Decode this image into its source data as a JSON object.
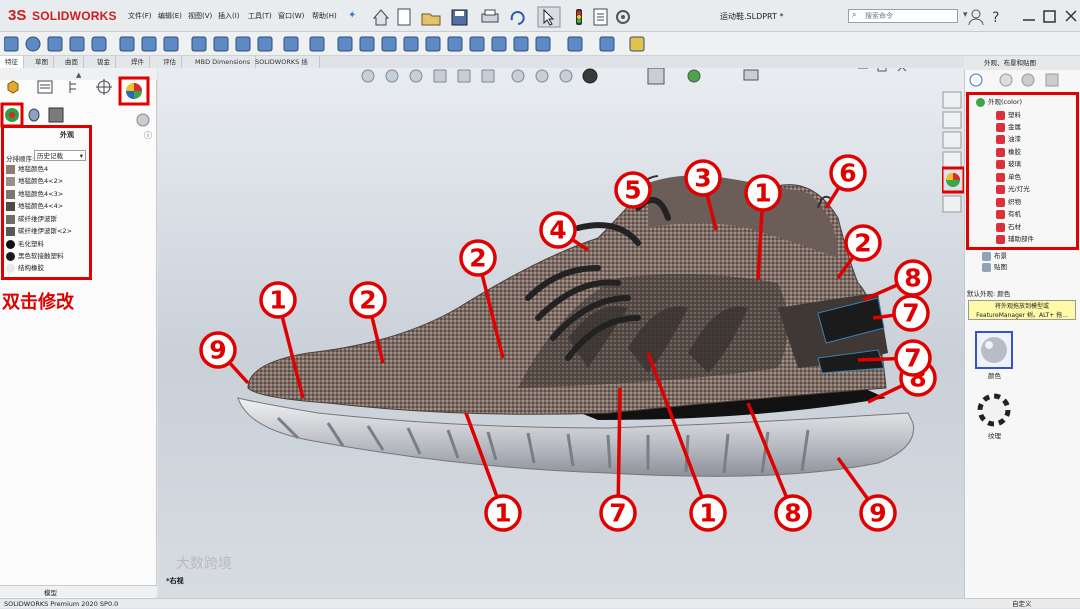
{
  "app": {
    "brand_prefix": "3S",
    "brand_name": "SOLIDWORKS",
    "menus": [
      "文件(F)",
      "编辑(E)",
      "视图(V)",
      "插入(I)",
      "工具(T)",
      "窗口(W)",
      "帮助(H)"
    ],
    "document_title": "运动鞋.SLDPRT *",
    "search_placeholder": "搜索命令"
  },
  "command_tabs": [
    "特征",
    "草图",
    "曲面",
    "钣金",
    "焊件",
    "评估",
    "MBD Dimensions",
    "SOLIDWORKS 插件"
  ],
  "left_panel": {
    "title": "外观",
    "sort_label": "分排顺序:",
    "sort_value": "历史记载",
    "items": [
      {
        "label": "地毯颜色4",
        "color": "#8c7c72"
      },
      {
        "label": "地毯颜色4<2>",
        "color": "#9a8e88"
      },
      {
        "label": "地毯颜色4<3>",
        "color": "#7d756f"
      },
      {
        "label": "地毯颜色4<4>",
        "color": "#4e4a48"
      },
      {
        "label": "碳纤维伊波斯",
        "color": "#6f6b69"
      },
      {
        "label": "碳纤维伊波斯<2>",
        "color": "#5a5755"
      },
      {
        "label": "毛化塑料",
        "color": "#111111"
      },
      {
        "label": "黑色软接触塑料",
        "color": "#1a1a1a"
      },
      {
        "label": "结构橡胶",
        "color": "#e8e8e8"
      }
    ],
    "edit_note": "双击修改"
  },
  "viewport": {
    "view_label": "*右视",
    "callouts": [
      "1",
      "2",
      "3",
      "4",
      "5",
      "6",
      "1",
      "2",
      "8",
      "7",
      "8",
      "1",
      "2",
      "9",
      "1",
      "7",
      "1",
      "8",
      "9"
    ]
  },
  "right_panel": {
    "header": "外观、布景和贴图",
    "root_label": "外观(color)",
    "categories": [
      "塑料",
      "金属",
      "油漆",
      "橡胶",
      "玻璃",
      "单色",
      "光/灯光",
      "织物",
      "有机",
      "石材",
      "辅助部件"
    ],
    "scene_label": "布景",
    "decal_label": "贴图",
    "default_appearance": "默认外观: 颜色",
    "tooltip": "将外观拖放到模型或 FeatureManager 树。ALT+ 拖...",
    "swatch_color_label": "颜色",
    "swatch_texture_label": "纹理"
  },
  "status": {
    "version": "SOLIDWORKS Premium 2020 SP0.0",
    "custom": "自定义",
    "watermark": "大数跨境",
    "model_tab": "模型"
  },
  "colors": {
    "accent_red": "#e00000",
    "solidworks_red": "#d01c1c"
  }
}
